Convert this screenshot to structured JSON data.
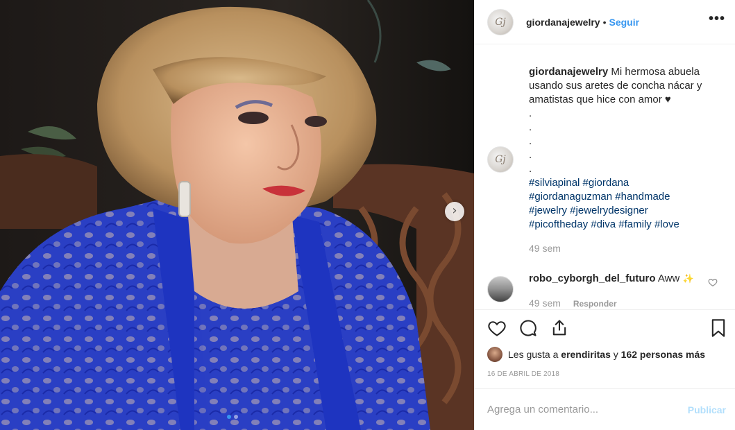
{
  "post": {
    "username": "giordanajewelry",
    "separator": "•",
    "follow_label": "Seguir",
    "more_icon": "more-options-icon",
    "avatar_text": "Gj"
  },
  "caption": {
    "username": "giordanajewelry",
    "text": "Mi hermosa abuela usando sus aretes de concha nácar y amatistas que hice con amor ♥",
    "dots": [
      ".",
      ".",
      ".",
      ".",
      "."
    ],
    "hashtags_lines": [
      "#silviapinal #giordana",
      "#giordanaguzman #handmade",
      "#jewelry #jewelrydesigner",
      "#picoftheday #diva #family #love"
    ],
    "time": "49 sem"
  },
  "comment": {
    "username": "robo_cyborgh_del_futuro",
    "text": "Aww",
    "emoji": "✨",
    "time": "49 sem",
    "reply_label": "Responder"
  },
  "likes": {
    "prefix": "Les gusta a",
    "user": "erendiritas",
    "connector": "y",
    "others": "162 personas más"
  },
  "date": "16 DE ABRIL DE 2018",
  "add_comment": {
    "placeholder": "Agrega un comentario...",
    "post_label": "Publicar"
  },
  "carousel": {
    "current": 1,
    "total": 2,
    "accent": "#3897f0"
  },
  "colors": {
    "link": "#3897f0",
    "hashtag": "#003569",
    "muted": "#999999"
  }
}
